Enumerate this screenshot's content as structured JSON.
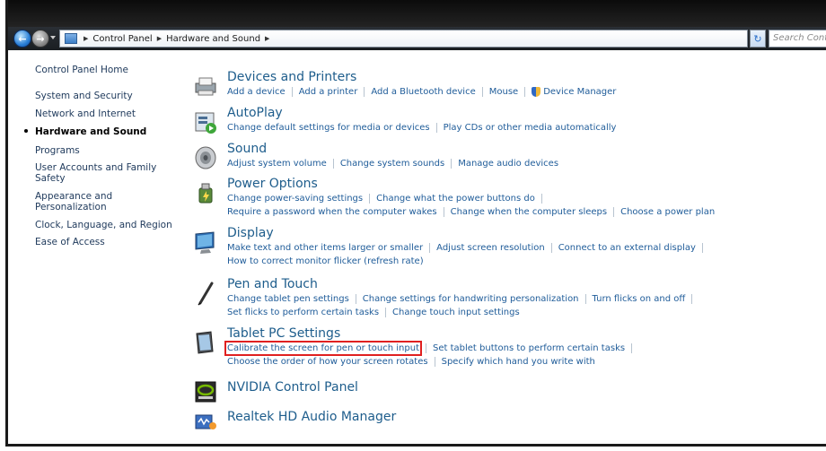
{
  "address_bar": {
    "crumbs": [
      "Control Panel",
      "Hardware and Sound"
    ],
    "search_placeholder": "Search Control Panel"
  },
  "sidebar": {
    "items": [
      {
        "label": "Control Panel Home"
      },
      {
        "label": "System and Security"
      },
      {
        "label": "Network and Internet"
      },
      {
        "label": "Hardware and Sound",
        "active": true
      },
      {
        "label": "Programs"
      },
      {
        "label": "User Accounts and Family Safety"
      },
      {
        "label": "Appearance and Personalization"
      },
      {
        "label": "Clock, Language, and Region"
      },
      {
        "label": "Ease of Access"
      }
    ]
  },
  "categories": [
    {
      "title": "Devices and Printers",
      "icon": "printer-icon",
      "rows": [
        [
          "Add a device",
          "Add a printer",
          "Add a Bluetooth device",
          "Mouse",
          "Device Manager"
        ]
      ]
    },
    {
      "title": "AutoPlay",
      "icon": "autoplay-icon",
      "rows": [
        [
          "Change default settings for media or devices",
          "Play CDs or other media automatically"
        ]
      ]
    },
    {
      "title": "Sound",
      "icon": "speaker-icon",
      "rows": [
        [
          "Adjust system volume",
          "Change system sounds",
          "Manage audio devices"
        ]
      ]
    },
    {
      "title": "Power Options",
      "icon": "power-icon",
      "rows": [
        [
          "Change power-saving settings",
          "Change what the power buttons do"
        ],
        [
          "Require a password when the computer wakes",
          "Change when the computer sleeps",
          "Choose a power plan"
        ]
      ]
    },
    {
      "title": "Display",
      "icon": "display-icon",
      "rows": [
        [
          "Make text and other items larger or smaller",
          "Adjust screen resolution",
          "Connect to an external display"
        ],
        [
          "How to correct monitor flicker (refresh rate)"
        ]
      ]
    },
    {
      "title": "Pen and Touch",
      "icon": "pen-icon",
      "rows": [
        [
          "Change tablet pen settings",
          "Change settings for handwriting personalization",
          "Turn flicks on and off"
        ],
        [
          "Set flicks to perform certain tasks",
          "Change touch input settings"
        ]
      ]
    },
    {
      "title": "Tablet PC Settings",
      "icon": "tablet-icon",
      "rows": [
        [
          "Calibrate the screen for pen or touch input",
          "Set tablet buttons to perform certain tasks"
        ],
        [
          "Choose the order of how your screen rotates",
          "Specify which hand you write with"
        ]
      ]
    },
    {
      "title": "NVIDIA Control Panel",
      "icon": "nvidia-icon",
      "rows": []
    },
    {
      "title": "Realtek HD Audio Manager",
      "icon": "realtek-icon",
      "rows": []
    }
  ]
}
